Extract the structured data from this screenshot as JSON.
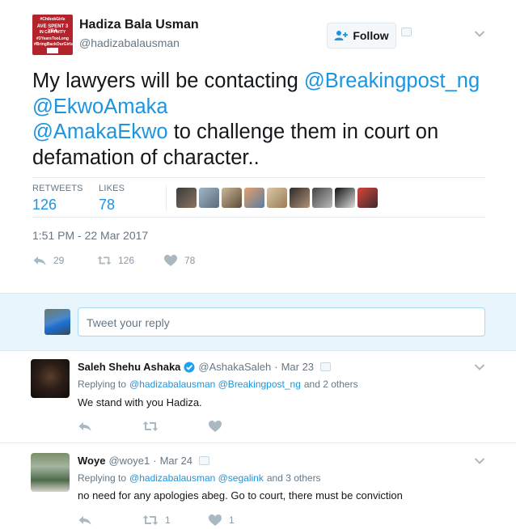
{
  "tweet": {
    "author_name": "Hadiza Bala Usman",
    "author_handle": "@hadizabalausman",
    "avatar_text": [
      "#ChibokGirls",
      "AVE SPENT 3 YEA",
      "IN CAPTIVITY",
      "#3YearsTooLong",
      "#BringBackOurGirls"
    ],
    "follow_label": "Follow",
    "text_part1": "My lawyers will be contacting ",
    "mention1": "@Breakingpost_ng",
    "text_part2": " ",
    "mention2": "@EkwoAmaka",
    "text_part3": " ",
    "mention3": "@AmakaEkwo",
    "text_part4": " to challenge them in court on defamation of character..",
    "retweets_label": "RETWEETS",
    "retweets_value": "126",
    "likes_label": "LIKES",
    "likes_value": "78",
    "timestamp": "1:51 PM - 22 Mar 2017",
    "reply_count": "29",
    "retweet_count": "126",
    "like_count": "78"
  },
  "composer": {
    "placeholder": "Tweet your reply"
  },
  "replies": [
    {
      "name": "Saleh Shehu Ashaka",
      "verified": true,
      "handle": "@AshakaSaleh",
      "date": "Mar 23",
      "replying_prefix": "Replying to",
      "replying_mentions": "@hadizabalausman @Breakingpost_ng",
      "replying_suffix": "and 2 others",
      "text": "We stand with you Hadiza.",
      "retweets": "",
      "likes": ""
    },
    {
      "name": "Woye",
      "verified": false,
      "handle": "@woye1",
      "date": "Mar 24",
      "replying_prefix": "Replying to",
      "replying_mentions": "@hadizabalausman @segalink",
      "replying_suffix": "and 3 others",
      "text": "no need for any apologies abeg. Go to court, there must be conviction",
      "retweets": "1",
      "likes": "1"
    }
  ],
  "colors": {
    "link": "#1b95e0",
    "muted": "#657786",
    "composer_bg": "#e8f5fd",
    "avatar_red": "#b3232c"
  },
  "icons": [
    "follow-person-plus-icon",
    "chevron-down-icon",
    "reply-icon",
    "retweet-icon",
    "heart-icon",
    "verified-badge-icon",
    "translate-icon"
  ]
}
